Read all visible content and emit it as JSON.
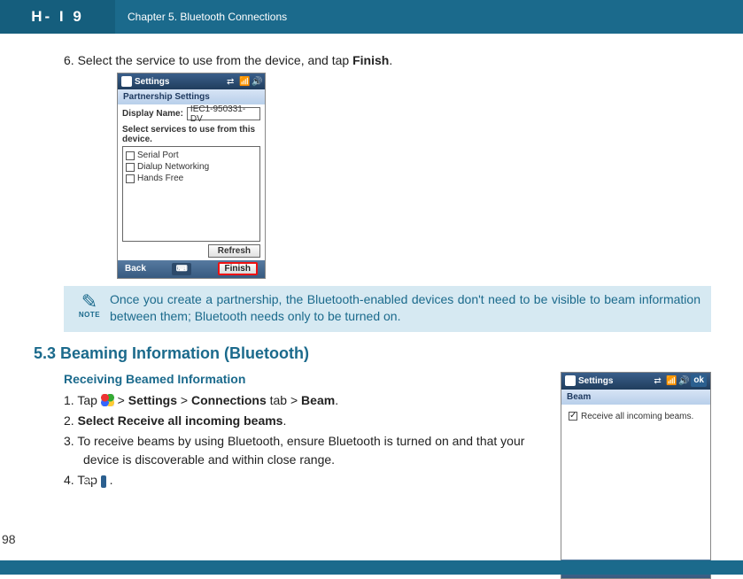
{
  "header": {
    "logo_text": "H- I 9",
    "chapter": "Chapter 5. Bluetooth Connections"
  },
  "page_number": "98",
  "step6": {
    "prefix": "6. Select the service to use from the device, and tap ",
    "bold": "Finish",
    "suffix": "."
  },
  "shot1": {
    "title": "Settings",
    "section": "Partnership Settings",
    "display_name_label": "Display Name:",
    "display_name_value": "IEC1-950331-DV",
    "select_label": "Select services to use from this device.",
    "items": [
      "Serial Port",
      "Dialup Networking",
      "Hands Free"
    ],
    "refresh": "Refresh",
    "soft_left": "Back",
    "soft_right": "Finish"
  },
  "note": {
    "label": "NOTE",
    "text": "Once you create a partnership, the Bluetooth-enabled devices don't need to be visible to beam information between them; Bluetooth needs only to be turned on."
  },
  "section_53": "5.3 Beaming Information (Bluetooth)",
  "receiving": {
    "title": "Receiving Beamed Information",
    "s1": {
      "n": "1. ",
      "tap": "Tap ",
      "gt1": " > ",
      "settings": "Settings",
      "gt2": " > ",
      "connections": "Connections",
      "tab": " tab > ",
      "beam": "Beam",
      "end": "."
    },
    "s2": {
      "n": "2. ",
      "bold": "Select Receive all incoming beams",
      "end": "."
    },
    "s3": "3. To receive beams by using Bluetooth, ensure Bluetooth is turned on and that your device is discoverable and within close range.",
    "s4": {
      "n": "4. ",
      "tap": "Tap ",
      "ok": "ok",
      "end": " ."
    }
  },
  "shot2": {
    "title": "Settings",
    "ok": "ok",
    "band": "Beam",
    "check_label": "Receive all incoming beams."
  }
}
